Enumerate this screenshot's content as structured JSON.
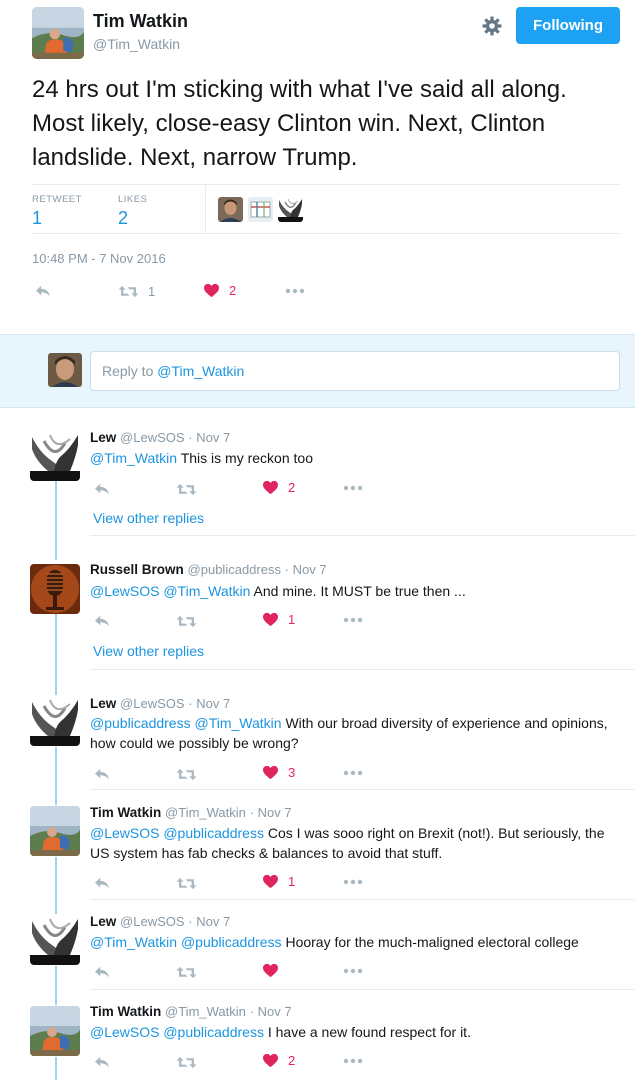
{
  "main_tweet": {
    "name": "Tim Watkin",
    "handle": "@Tim_Watkin",
    "follow_label": "Following",
    "text": "24 hrs out I'm sticking with what I've said all along. Most likely, close-easy Clinton win. Next, Clinton landslide. Next, narrow Trump.",
    "retweets_label": "RETWEET",
    "retweets": "1",
    "likes_label": "LIKES",
    "likes": "2",
    "timestamp": "10:48 PM - 7 Nov 2016",
    "action_retweets": "1",
    "action_likes": "2"
  },
  "reply_box": {
    "prefix": "Reply to ",
    "mention": "@Tim_Watkin"
  },
  "replies": [
    {
      "name": "Lew",
      "handle": "@LewSOS",
      "date": "· Nov 7",
      "mentions": "@Tim_Watkin",
      "text": " This is my reckon too",
      "likes": "2",
      "view_more": "View other replies"
    },
    {
      "name": "Russell Brown",
      "handle": "@publicaddress",
      "date": "· Nov 7",
      "mentions": "@LewSOS @Tim_Watkin",
      "text": " And mine. It MUST be true then ...",
      "likes": "1",
      "view_more": "View other replies"
    },
    {
      "name": "Lew",
      "handle": "@LewSOS",
      "date": "· Nov 7",
      "mentions": "@publicaddress @Tim_Watkin",
      "text": " With our broad diversity of experience and opinions, how could we possibly be wrong?",
      "likes": "3"
    },
    {
      "name": "Tim Watkin",
      "handle": "@Tim_Watkin",
      "date": "· Nov 7",
      "mentions": "@LewSOS @publicaddress",
      "text": " Cos I was sooo right on Brexit (not!). But seriously, the US system has fab checks & balances to avoid that stuff.",
      "likes": "1"
    },
    {
      "name": "Lew",
      "handle": "@LewSOS",
      "date": "· Nov 7",
      "mentions": "@Tim_Watkin @publicaddress",
      "text": " Hooray for the much-maligned electoral college",
      "likes": ""
    },
    {
      "name": "Tim Watkin",
      "handle": "@Tim_Watkin",
      "date": "· Nov 7",
      "mentions": "@LewSOS @publicaddress",
      "text": " I have a new found respect for it.",
      "likes": "2"
    }
  ],
  "colors": {
    "link_blue": "#1b95e0",
    "button_blue": "#1da1f2",
    "like_red": "#e0245e",
    "muted": "#8899a6"
  }
}
